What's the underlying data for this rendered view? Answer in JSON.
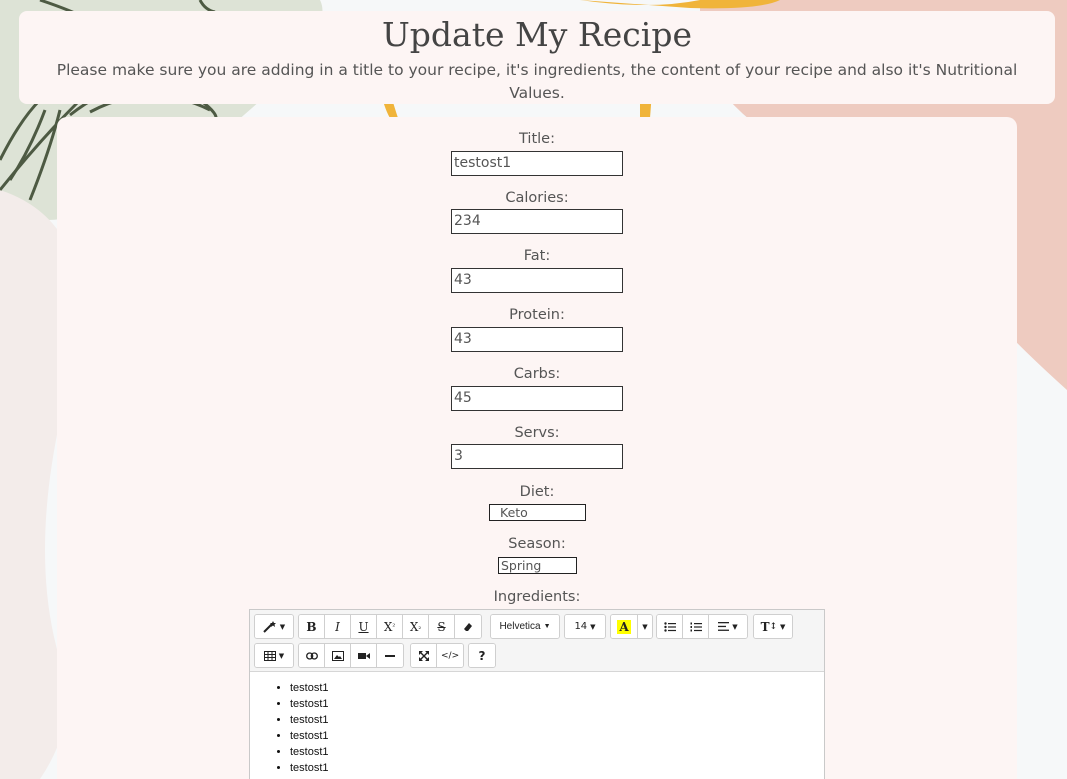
{
  "header": {
    "title": "Update My Recipe",
    "subtitle": "Please make sure you are adding in a title to your recipe, it's ingredients, the content of your recipe and also it's Nutritional Values."
  },
  "form": {
    "title": {
      "label": "Title:",
      "value": "testost1"
    },
    "calories": {
      "label": "Calories:",
      "value": "234"
    },
    "fat": {
      "label": "Fat:",
      "value": "43"
    },
    "protein": {
      "label": "Protein:",
      "value": "43"
    },
    "carbs": {
      "label": "Carbs:",
      "value": "45"
    },
    "servs": {
      "label": "Servs:",
      "value": "3"
    },
    "diet": {
      "label": "Diet:",
      "value": "Keto"
    },
    "season": {
      "label": "Season:",
      "value": "Spring"
    },
    "ingredients": {
      "label": "Ingredients:"
    }
  },
  "editor": {
    "toolbar": {
      "font_family": "Helvetica",
      "font_size": "14",
      "bold": "B",
      "italic": "I",
      "underline": "U",
      "superscript": "X",
      "subscript": "X",
      "strikethrough": "S",
      "text_color": "A",
      "font_style": "T",
      "help": "?",
      "codeview": "</>"
    },
    "items": [
      "testost1",
      "testost1",
      "testost1",
      "testost1",
      "testost1",
      "testost1"
    ]
  },
  "colors": {
    "card_bg": "#fdf5f4",
    "leaf_green": "#5d6b52",
    "sage": "#dde3d6",
    "peach": "#eecbc0",
    "mustard": "#f0b43a"
  }
}
